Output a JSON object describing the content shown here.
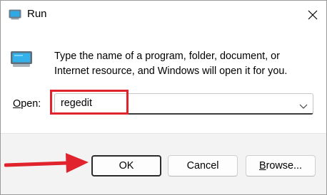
{
  "window": {
    "title": "Run",
    "title_icon": "run-icon",
    "close_icon": "close-icon"
  },
  "main": {
    "icon": "run-icon",
    "description": "Type the name of a program, folder, document, or Internet resource, and Windows will open it for you.",
    "open_label_accel": "O",
    "open_label_rest": "pen:",
    "open_value": "regedit",
    "dropdown_icon": "chevron-down-icon"
  },
  "buttons": {
    "ok": "OK",
    "cancel": "Cancel",
    "browse_accel": "B",
    "browse_rest": "rowse..."
  },
  "annotations": {
    "highlight_color": "#e0232c",
    "arrow_color": "#e0232c"
  }
}
